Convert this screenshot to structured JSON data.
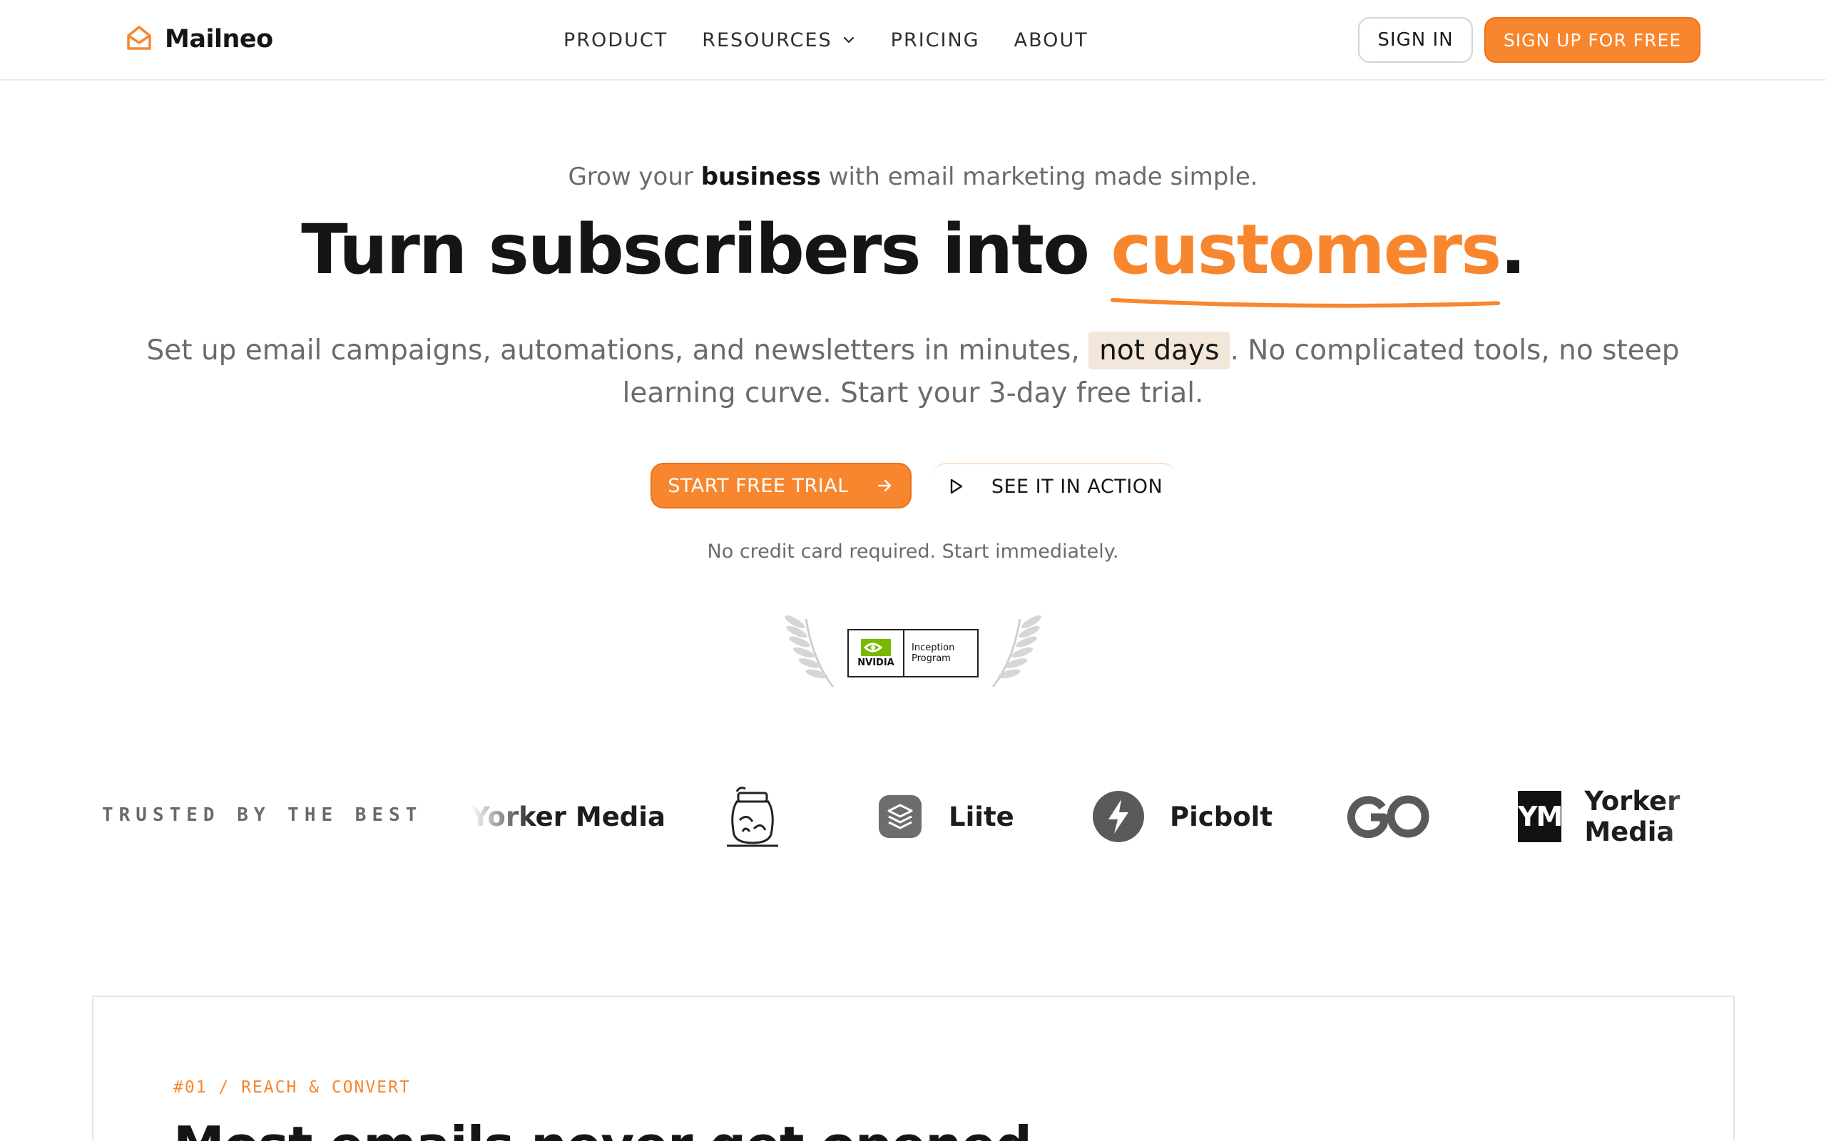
{
  "brand": {
    "name": "Mailneo",
    "logo_icon": "envelope-icon",
    "accent_color": "#f7862e"
  },
  "nav": {
    "items": [
      {
        "label": "PRODUCT"
      },
      {
        "label": "RESOURCES",
        "icon": "chevron-down-icon"
      },
      {
        "label": "PRICING"
      },
      {
        "label": "ABOUT"
      }
    ]
  },
  "header": {
    "signin_label": "SIGN IN",
    "signup_label": "SIGN UP FOR FREE"
  },
  "hero": {
    "eyebrow_pre": "Grow your ",
    "eyebrow_bold": "business",
    "eyebrow_post": " with email marketing made simple.",
    "headline_pre": "Turn subscribers into ",
    "headline_accent": "customers",
    "headline_post": ".",
    "sub_pre": "Set up email campaigns, automations, and newsletters in minutes, ",
    "sub_highlight": "not days",
    "sub_post": ". No complicated tools, no steep learning curve. Start your 3-day free trial.",
    "primary_cta": "START FREE TRIAL",
    "secondary_cta": "SEE IT IN ACTION",
    "note": "No credit card required. Start immediately."
  },
  "award": {
    "brand": "NVIDIA",
    "line1": "Inception",
    "line2": "Program"
  },
  "trusted": {
    "label": "TRUSTED BY THE BEST",
    "logos": [
      {
        "name": "Yorker Media",
        "icon": ""
      },
      {
        "name": "",
        "icon": "jar-icon"
      },
      {
        "name": "Liite",
        "icon": "layers-icon"
      },
      {
        "name": "Picbolt",
        "icon": "bolt-icon"
      },
      {
        "name": "",
        "icon": "go-logo-icon"
      },
      {
        "name": "Yorker Media",
        "icon": "ym-logo-icon",
        "mark": "YM"
      }
    ]
  },
  "feature": {
    "tag": "#01 / REACH & CONVERT",
    "title": "Most emails never get opened."
  }
}
